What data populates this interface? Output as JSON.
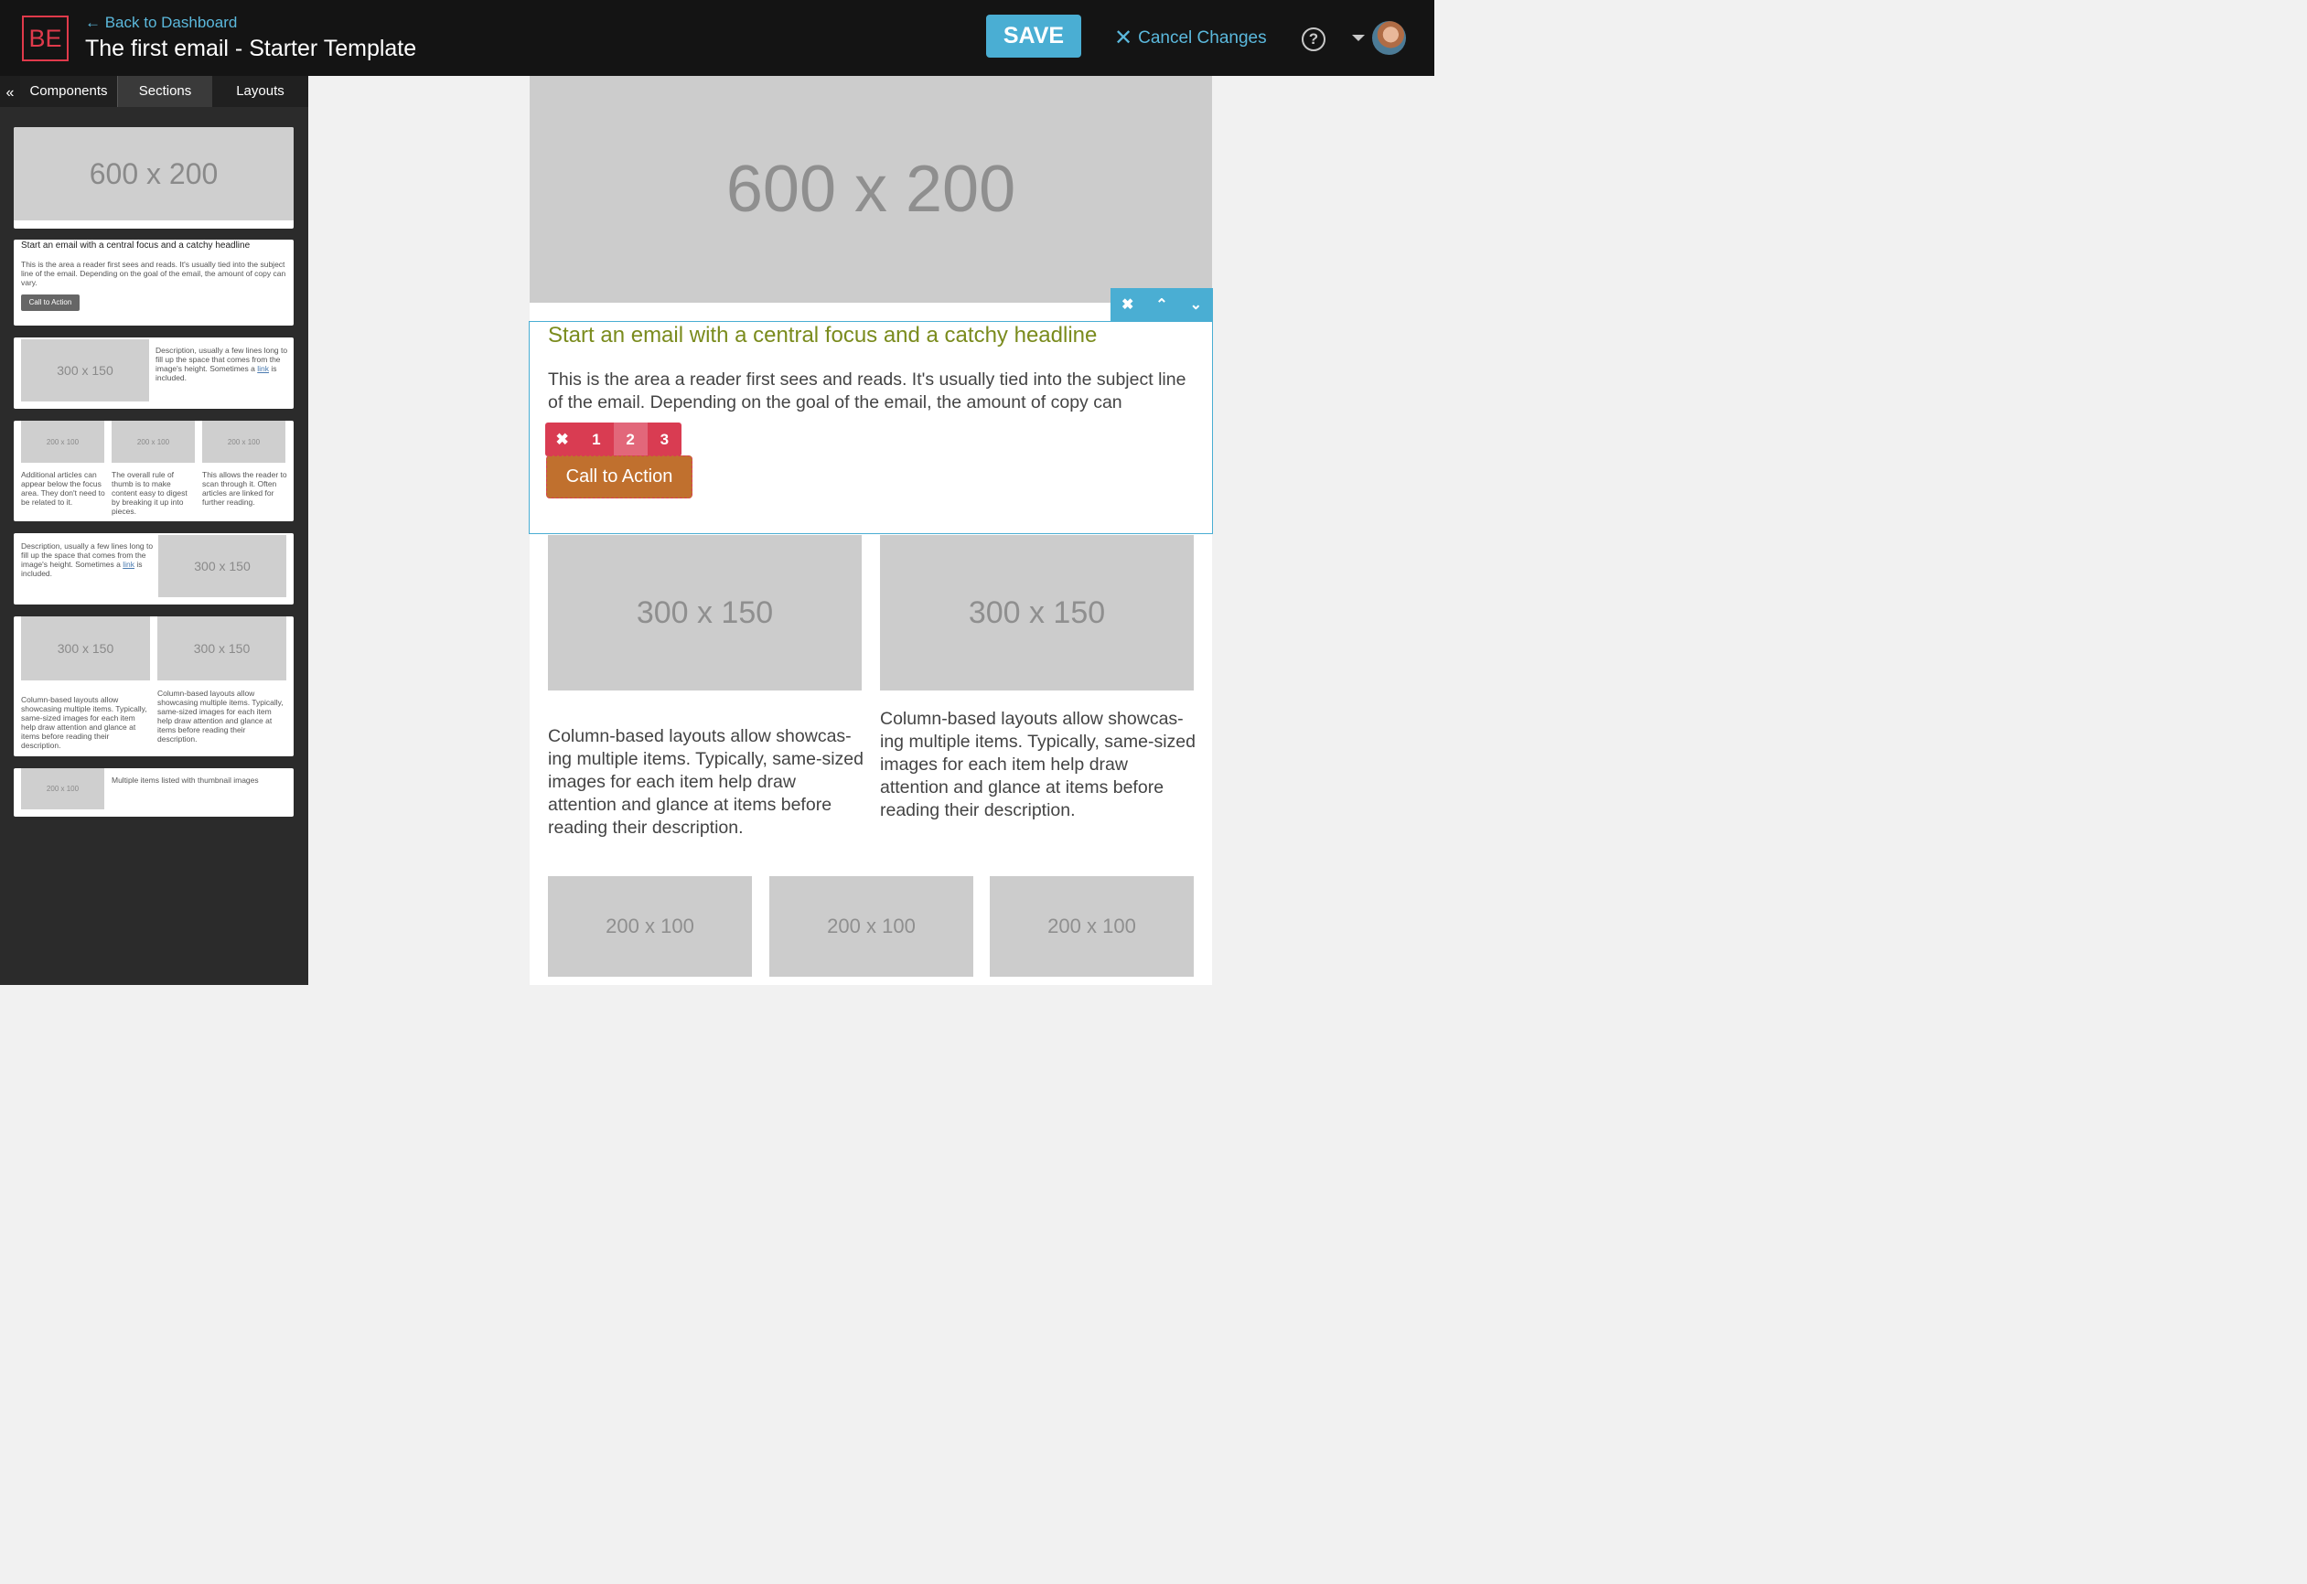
{
  "header": {
    "logo_text": "BE",
    "back_link": "← Back to Dashboard",
    "title": "The first email - Starter Template",
    "save_label": "SAVE",
    "cancel_label": "Cancel Changes",
    "help_glyph": "?"
  },
  "sidebar": {
    "collapse_glyph": "«",
    "tabs": [
      "Components",
      "Sections",
      "Layouts"
    ],
    "active_tab": "Sections",
    "thumbs": {
      "hero_label": "600 x 200",
      "focus_headline": "Start an email with a central focus and a catchy headline",
      "focus_body": "This is the area a reader first sees and reads. It's usually tied into the subject line of the email. Depending on the goal of the email, the amount of copy can vary.",
      "focus_cta": "Call to Action",
      "img_300": "300 x 150",
      "img_200": "200 x 100",
      "desc_before": "Description, usually a few lines long to fill up the space that comes from the image's height. Sometimes a ",
      "desc_link": "link",
      "desc_after": " is included.",
      "three_col": [
        "Additional articles can appear below the focus area. They don't need to be related to it.",
        "The overall rule of thumb is to make content easy to digest by breaking it up into pieces.",
        "This allows the reader to scan through it. Often articles are linked for further reading."
      ],
      "two_col_text": "Column-based layouts allow showcasing multiple items. Typically, same-sized images for each item help draw attention and glance at items before reading their description.",
      "list_text": "Multiple items listed with thumbnail images"
    }
  },
  "email": {
    "hero_label": "600 x 200",
    "section_tools": [
      "✖",
      "⌃",
      "⌄"
    ],
    "headline": "Start an email with a central focus and a catchy headline",
    "body": "This is the area a reader first sees and reads. It's usually tied into the subject line of the email. Depending on the goal of the email, the amount of copy can",
    "button_tools": [
      "✖",
      "1",
      "2",
      "3"
    ],
    "active_button_style": "2",
    "cta_label": "Call to Action",
    "columns": [
      {
        "image": "300 x 150",
        "text": "Column-based layouts allow showcas-ing multiple items. Typically, same-sized images for each item help draw attention and glance at items before reading their description."
      },
      {
        "image": "300 x 150",
        "text": "Column-based layouts allow showcas-ing multiple items. Typically, same-sized images for each item help draw attention and glance at items before reading their description."
      }
    ],
    "tri_images": [
      "200 x 100",
      "200 x 100",
      "200 x 100"
    ]
  },
  "colors": {
    "accent_blue": "#4aaed3",
    "brand_red": "#e03a4b",
    "headline_olive": "#7a8b1d",
    "cta_orange": "#c0702e",
    "tool_red": "#d93c52"
  }
}
